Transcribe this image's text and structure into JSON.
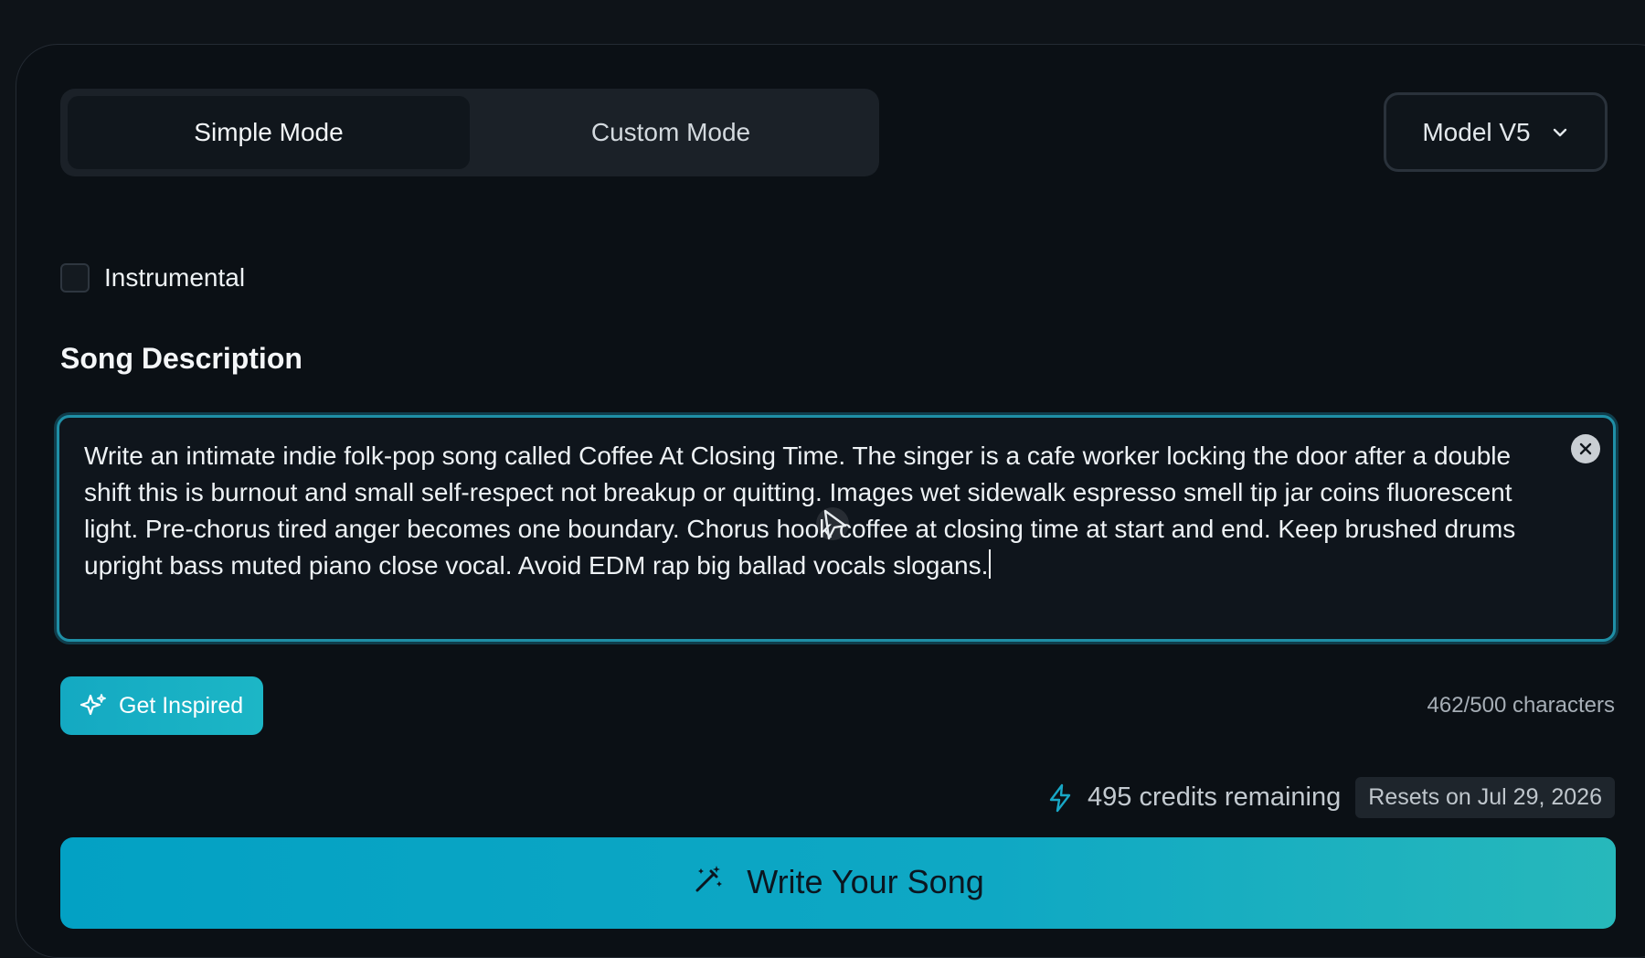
{
  "mode_toggle": {
    "simple_label": "Simple Mode",
    "custom_label": "Custom Mode"
  },
  "model_select": {
    "value": "Model V5"
  },
  "instrumental": {
    "label": "Instrumental",
    "checked": false
  },
  "song_description": {
    "title": "Song Description",
    "value": "Write an intimate indie folk-pop song called Coffee At Closing Time. The singer is a cafe worker locking the door after a double shift this is burnout and small self-respect not breakup or quitting. Images wet sidewalk espresso smell tip jar coins fluorescent light. Pre-chorus tired anger becomes one boundary. Chorus hook coffee at closing time at start and end. Keep brushed drums upright bass muted piano close vocal. Avoid EDM rap big ballad vocals slogans."
  },
  "inspire_button": {
    "label": "Get Inspired"
  },
  "char_count": "462/500 characters",
  "credits": {
    "text": "495 credits remaining",
    "reset_text": "Resets on Jul 29, 2026"
  },
  "write_button": {
    "label": "Write Your Song"
  },
  "colors": {
    "accent": "#14a9c2",
    "focus_border": "#1f8fa6",
    "background": "#0b1015"
  }
}
